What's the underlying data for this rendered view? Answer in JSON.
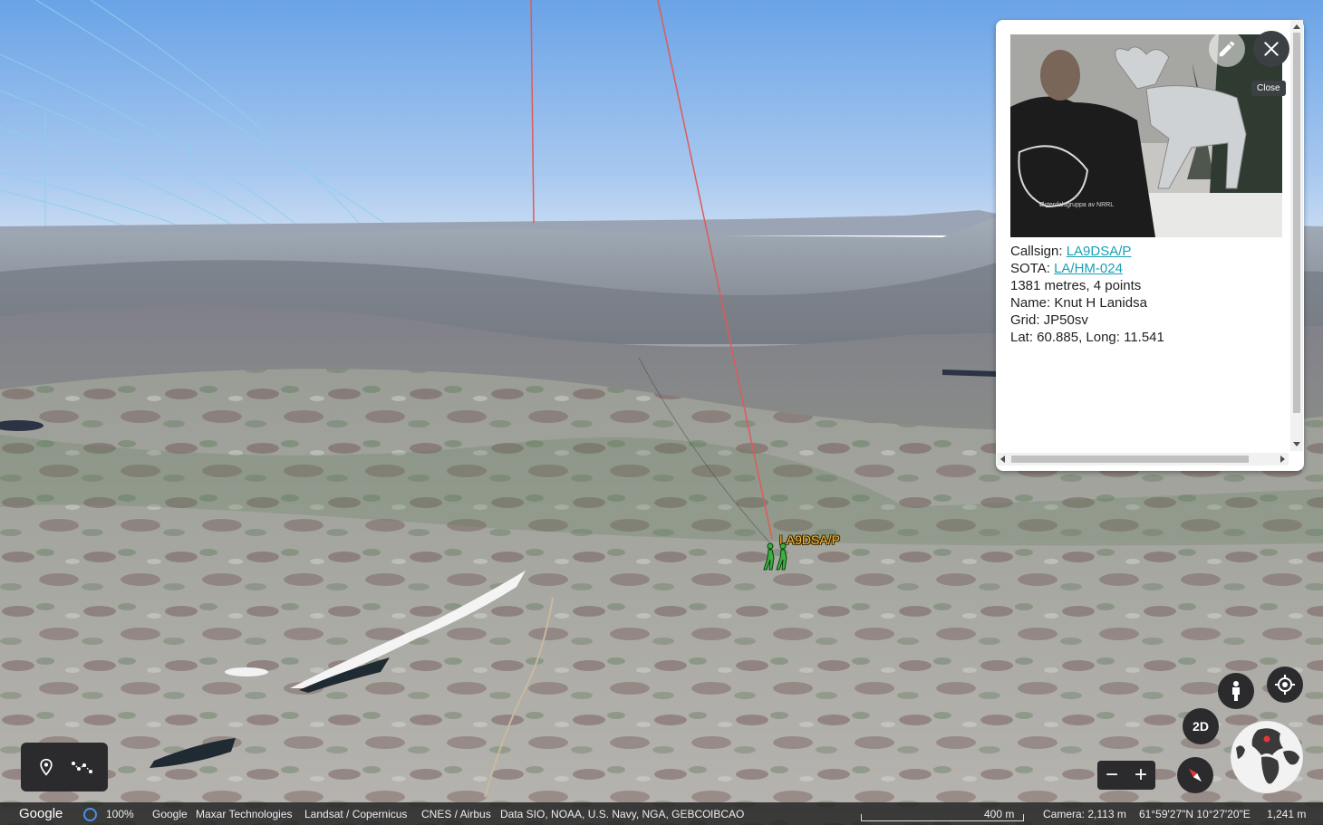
{
  "placemark": {
    "label": "LA9DSA/P",
    "icon": "hiker-icon"
  },
  "balloon": {
    "photo_alt": "Photo of a person in a black jacket next to a metal moose sculpture",
    "callsign_label": "Callsign:",
    "callsign_value": "LA9DSA/P",
    "sota_label": "SOTA:",
    "sota_value": "LA/HM-024",
    "elevation_points": "1381 metres, 4 points",
    "name": "Name: Knut H Lanidsa",
    "grid": "Grid: JP50sv",
    "latlong": "Lat: 60.885, Long: 11.541",
    "edit_icon": "pencil-icon",
    "close_icon": "close-icon",
    "close_tooltip": "Close"
  },
  "toolbar": {
    "items": [
      {
        "name": "add-placemark",
        "icon": "map-pin-icon"
      },
      {
        "name": "draw-path",
        "icon": "path-icon"
      }
    ]
  },
  "controls": {
    "twod_label": "2D",
    "zoom_out_label": "−",
    "zoom_in_label": "+",
    "pegman_icon": "pegman-icon",
    "locate_icon": "my-location-icon",
    "compass_icon": "compass-icon",
    "globe_icon": "globe-icon"
  },
  "statusbar": {
    "logo": "Google",
    "load_percent": "100%",
    "attributions": [
      "Google",
      "Maxar Technologies",
      "Landsat / Copernicus",
      "CNES / Airbus",
      "Data SIO, NOAA, U.S. Navy, NGA, GEBCO",
      "IBCAO"
    ],
    "scale": "400 m",
    "camera": "Camera: 2,113 m",
    "coordinates": "61°59'27\"N 10°27'20\"E",
    "elevation": "1,241 m"
  }
}
